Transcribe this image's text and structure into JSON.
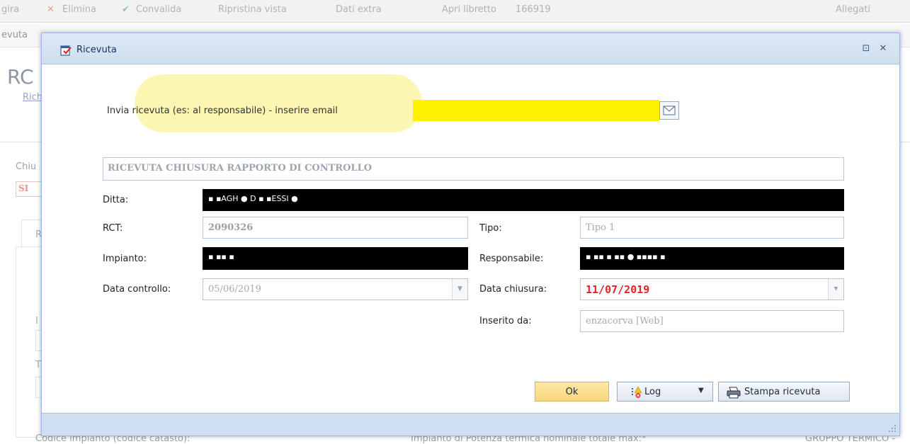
{
  "background": {
    "toolbar_row1": [
      "gira",
      "Elimina",
      "Convalida",
      "Ripristina vista",
      "Dati extra",
      "Apri libretto",
      "166919",
      "Allegati"
    ],
    "toolbar_row2_item": "evuta",
    "page_title": "RC",
    "page_link": "Rich",
    "field_label_chiu": "Chiu",
    "field_value_si": "SI",
    "tab_label": "R",
    "label_i": "I",
    "label_t": "T",
    "bottom_left": "Codice impianto (codice catasto):",
    "bottom_mid": "Impianto di Potenza termica nominale totale max:*",
    "bottom_right": "GRUPPO TERMICO -"
  },
  "modal": {
    "title": "Ricevuta",
    "email_label": "Invia ricevuta (es: al responsabile) - inserire email",
    "email_value": "",
    "receipt_header": "RICEVUTA CHIUSURA RAPPORTO DI CONTROLLO",
    "labels": {
      "ditta": "Ditta:",
      "rct": "RCT:",
      "tipo": "Tipo:",
      "impianto": "Impianto:",
      "responsabile": "Responsabile:",
      "data_controllo": "Data controllo:",
      "data_chiusura": "Data chiusura:",
      "inserito_da": "Inserito da:"
    },
    "values": {
      "ditta": "▪ ▪AGH ● D ▪ ▪ESSI ●",
      "rct": "2090326",
      "tipo": "Tipo 1",
      "impianto": "▪ ▪▪ ▪",
      "responsabile": "▪ ▪▪ ▪ ▪▪ ● ▪▪▪▪ ▪",
      "data_controllo": "05/06/2019",
      "data_chiusura": "11/07/2019",
      "inserito_da": "enzacorva [Web]"
    },
    "buttons": {
      "ok": "Ok",
      "log": "Log",
      "print": "Stampa ricevuta"
    },
    "colors": {
      "email_field": "#fff200",
      "highlight": "#fbf7b3",
      "date_red": "#e0242a",
      "header_bg": "#cfdef0"
    }
  }
}
